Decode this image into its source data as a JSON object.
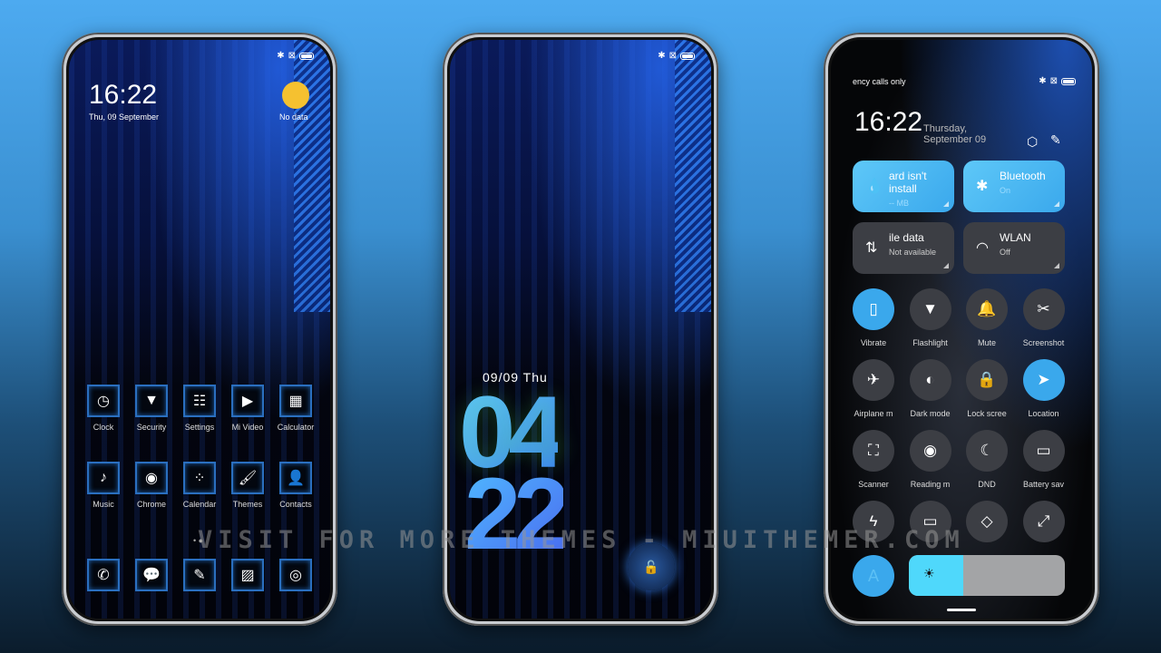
{
  "home": {
    "time": "16:22",
    "date": "Thu, 09 September",
    "weather": "No data",
    "apps": [
      {
        "label": "Clock",
        "icon": "clock-icon",
        "g": "◷"
      },
      {
        "label": "Security",
        "icon": "security-icon",
        "g": "▼"
      },
      {
        "label": "Settings",
        "icon": "settings-icon",
        "g": "☷"
      },
      {
        "label": "Mi Video",
        "icon": "mi-video-icon",
        "g": "▶"
      },
      {
        "label": "Calculator",
        "icon": "calculator-icon",
        "g": "▦"
      },
      {
        "label": "Music",
        "icon": "music-icon",
        "g": "♪"
      },
      {
        "label": "Chrome",
        "icon": "chrome-icon",
        "g": "◉"
      },
      {
        "label": "Calendar",
        "icon": "calendar-icon",
        "g": "⁘"
      },
      {
        "label": "Themes",
        "icon": "themes-icon",
        "g": "🖌"
      },
      {
        "label": "Contacts",
        "icon": "contacts-icon",
        "g": "👤"
      }
    ],
    "dock": [
      {
        "icon": "phone-icon",
        "g": "✆"
      },
      {
        "icon": "messages-icon",
        "g": "💬"
      },
      {
        "icon": "notes-icon",
        "g": "✎"
      },
      {
        "icon": "gallery-icon",
        "g": "▨"
      },
      {
        "icon": "camera-icon",
        "g": "◎"
      }
    ]
  },
  "lock": {
    "date": "09/09 Thu",
    "hour": "04",
    "minute": "22"
  },
  "control": {
    "carrier": "ency calls only",
    "time": "16:22",
    "date": "Thursday, September 09",
    "cards": [
      {
        "title": "ard isn't install",
        "sub": "-- MB",
        "on": true,
        "g": "💧",
        "icon": "data-usage-icon"
      },
      {
        "title": "Bluetooth",
        "sub": "On",
        "on": true,
        "g": "✱",
        "icon": "bluetooth-icon"
      },
      {
        "title": "ile data",
        "sub": "Not available",
        "on": false,
        "g": "⇅",
        "icon": "mobile-data-icon"
      },
      {
        "title": "WLAN",
        "sub": "Off",
        "on": false,
        "g": "◠",
        "icon": "wifi-icon"
      }
    ],
    "toggles": [
      {
        "label": "Vibrate",
        "on": true,
        "g": "▯",
        "icon": "vibrate-icon"
      },
      {
        "label": "Flashlight",
        "on": false,
        "g": "▼",
        "icon": "flashlight-icon"
      },
      {
        "label": "Mute",
        "on": false,
        "g": "🔔",
        "icon": "bell-icon"
      },
      {
        "label": "Screenshot",
        "on": false,
        "g": "✂",
        "icon": "screenshot-icon"
      },
      {
        "label": "Airplane m",
        "on": false,
        "g": "✈",
        "icon": "airplane-icon"
      },
      {
        "label": "Dark mode",
        "on": false,
        "g": "◐",
        "icon": "dark-mode-icon"
      },
      {
        "label": "Lock scree",
        "on": false,
        "g": "🔒",
        "icon": "lock-icon"
      },
      {
        "label": "Location",
        "on": true,
        "g": "➤",
        "icon": "location-icon"
      },
      {
        "label": "Scanner",
        "on": false,
        "g": "⛶",
        "icon": "scanner-icon"
      },
      {
        "label": "Reading m",
        "on": false,
        "g": "◉",
        "icon": "eye-icon"
      },
      {
        "label": "DND",
        "on": false,
        "g": "☾",
        "icon": "moon-icon"
      },
      {
        "label": "Battery sav",
        "on": false,
        "g": "▭",
        "icon": "battery-saver-icon"
      },
      {
        "label": "",
        "on": false,
        "g": "ϟ",
        "icon": "lightning-icon"
      },
      {
        "label": "",
        "on": false,
        "g": "▭",
        "icon": "cast-icon"
      },
      {
        "label": "",
        "on": false,
        "g": "◇",
        "icon": "nearby-share-icon"
      },
      {
        "label": "",
        "on": false,
        "g": "⤢",
        "icon": "resize-icon"
      }
    ],
    "auto_brightness": "A",
    "brightness_percent": 35
  },
  "watermark": "VISIT FOR MORE THEMES - MIUITHEMER.COM",
  "colors": {
    "accent": "#3aa8ec",
    "brightness": "#4fd8fb"
  }
}
